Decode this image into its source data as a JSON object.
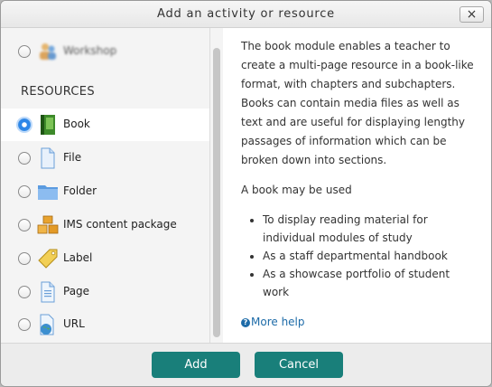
{
  "dialog": {
    "title": "Add an activity or resource",
    "close_label": "×"
  },
  "options": {
    "workshop": "Workshop",
    "resources_heading": "RESOURCES",
    "items": [
      {
        "label": "Book",
        "icon": "book-icon",
        "selected": true
      },
      {
        "label": "File",
        "icon": "file-icon"
      },
      {
        "label": "Folder",
        "icon": "folder-icon"
      },
      {
        "label": "IMS content package",
        "icon": "package-icon"
      },
      {
        "label": "Label",
        "icon": "label-icon"
      },
      {
        "label": "Page",
        "icon": "page-icon"
      },
      {
        "label": "URL",
        "icon": "url-icon"
      }
    ]
  },
  "description": {
    "para1": "The book module enables a teacher to create a multi-page resource in a book-like format, with chapters and subchapters. Books can contain media files as well as text and are useful for displaying lengthy passages of information which can be broken down into sections.",
    "para2": "A book may be used",
    "uses": [
      "To display reading material for individual modules of study",
      "As a staff departmental handbook",
      "As a showcase portfolio of student work"
    ],
    "help_glyph": "?",
    "more_help": "More help"
  },
  "footer": {
    "add_label": "Add",
    "cancel_label": "Cancel"
  },
  "colors": {
    "primary_button": "#197f7a",
    "link": "#1d6ba8"
  }
}
